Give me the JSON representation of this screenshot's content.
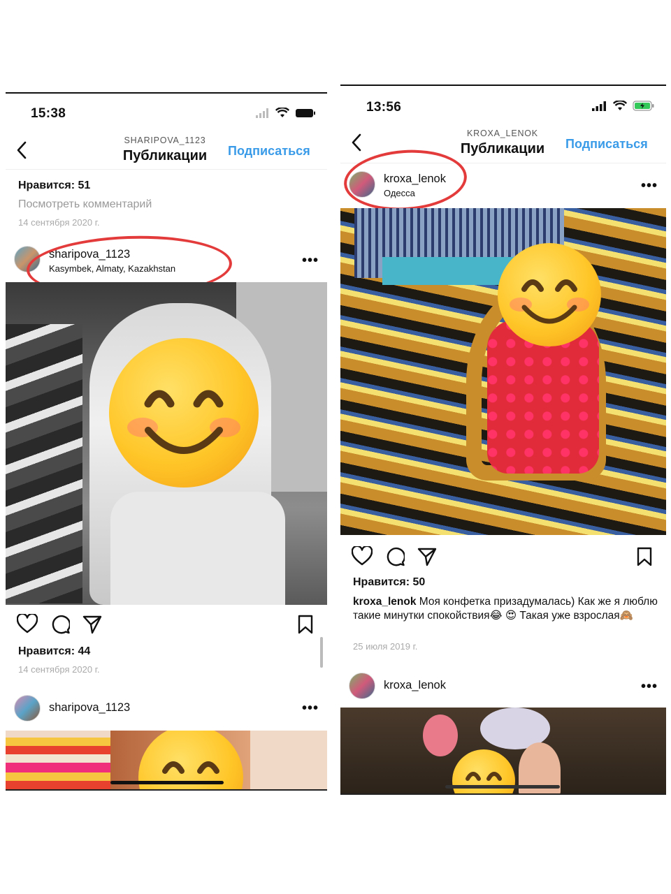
{
  "left": {
    "status": {
      "time": "15:38"
    },
    "nav": {
      "subtitle": "SHARIPOVA_1123",
      "title": "Публикации",
      "follow": "Подписаться"
    },
    "prev_post": {
      "likes": "Нравится: 51",
      "view_comments": "Посмотреть комментарий",
      "date": "14 сентября 2020 г."
    },
    "post": {
      "username": "sharipova_1123",
      "location": "Kasymbek, Almaty, Kazakhstan",
      "likes": "Нравится: 44",
      "date": "14 сентября 2020 г."
    },
    "next_post": {
      "username": "sharipova_1123"
    }
  },
  "right": {
    "status": {
      "time": "13:56"
    },
    "nav": {
      "subtitle": "KROXA_LENOK",
      "title": "Публикации",
      "follow": "Подписаться"
    },
    "post": {
      "username": "kroxa_lenok",
      "location": "Одесса",
      "likes": "Нравится: 50",
      "caption_user": "kroxa_lenok",
      "caption_text": "Моя конфетка призадумалась) Как же я люблю такие минутки спокойствия😂 😍  Такая уже взрослая🙈",
      "date": "25 июля 2019 г."
    },
    "next_post": {
      "username": "kroxa_lenok"
    }
  },
  "colors": {
    "accent_blue": "#3a9be8",
    "highlight_red": "#e33b3b",
    "battery_green": "#34c759"
  },
  "icons": [
    "back-chevron-icon",
    "heart-icon",
    "comment-icon",
    "share-icon",
    "bookmark-icon",
    "more-icon",
    "signal-icon",
    "wifi-icon",
    "battery-icon",
    "smiling-face-emoji"
  ]
}
